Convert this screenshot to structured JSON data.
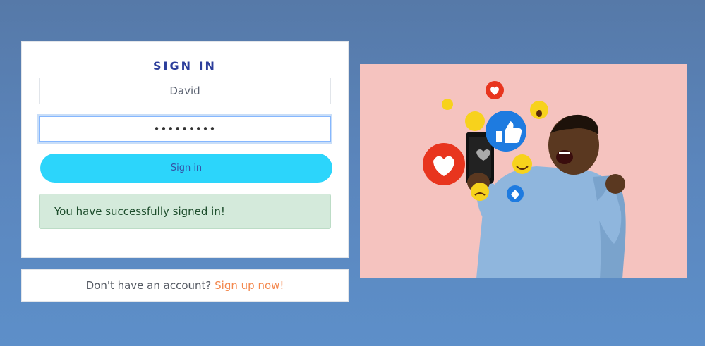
{
  "signin": {
    "title": "SIGN IN",
    "username_value": "David",
    "password_value": "•••••••••",
    "button_label": "Sign in",
    "success_message": "You have successfully signed in!"
  },
  "signup": {
    "prompt": "Don't have an account?",
    "link_label": "Sign up now!"
  },
  "colors": {
    "accent_button": "#2cd5fb",
    "title": "#2c3e9b",
    "signup_link": "#f3884e",
    "success_bg": "#d4eadb",
    "hero_bg": "#f5c3bf"
  }
}
